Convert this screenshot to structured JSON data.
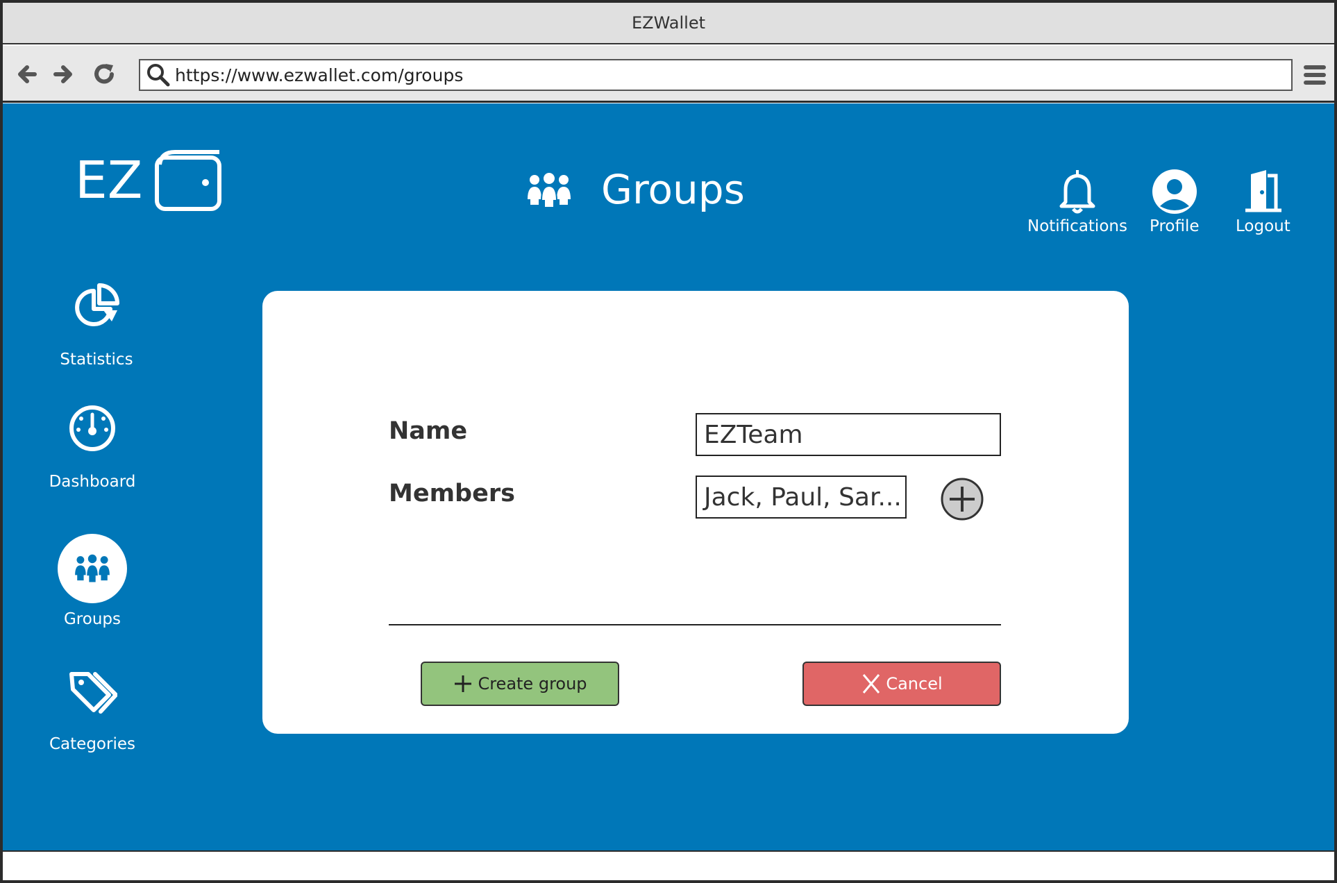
{
  "browser": {
    "window_title": "EZWallet",
    "url": "https://www.ezwallet.com/groups"
  },
  "header": {
    "logo_text": "EZ",
    "page_title": "Groups",
    "actions": [
      {
        "label": "Notifications",
        "icon": "bell-icon"
      },
      {
        "label": "Profile",
        "icon": "user-circle-icon"
      },
      {
        "label": "Logout",
        "icon": "door-exit-icon"
      }
    ]
  },
  "sidebar": {
    "items": [
      {
        "label": "Statistics",
        "icon": "pie-chart-icon",
        "active": false
      },
      {
        "label": "Dashboard",
        "icon": "gauge-icon",
        "active": false
      },
      {
        "label": "Groups",
        "icon": "people-group-icon",
        "active": true
      },
      {
        "label": "Categories",
        "icon": "tags-icon",
        "active": false
      }
    ]
  },
  "form": {
    "name_label": "Name",
    "name_value": "EZTeam",
    "members_label": "Members",
    "members_value": "Jack, Paul, Sar...",
    "create_button": "Create group",
    "cancel_button": "Cancel"
  },
  "colors": {
    "brand_blue": "#0077b8",
    "create_green": "#93c47d",
    "cancel_red": "#e06666"
  }
}
